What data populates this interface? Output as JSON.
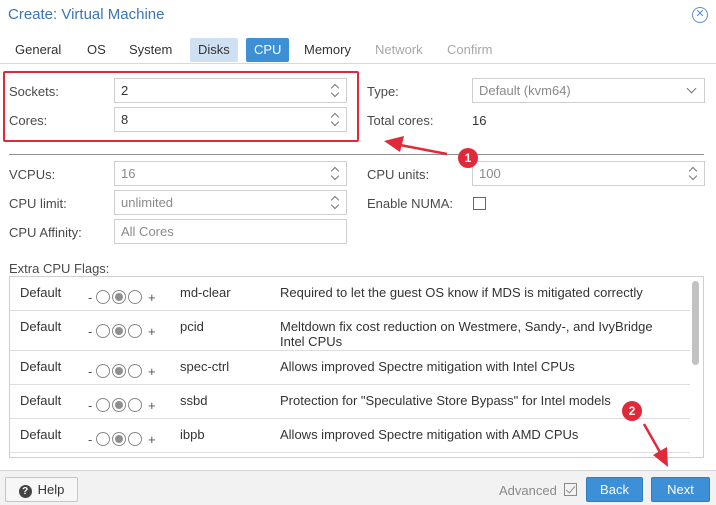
{
  "window": {
    "title": "Create: Virtual Machine"
  },
  "tabs": [
    {
      "label": "General"
    },
    {
      "label": "OS"
    },
    {
      "label": "System"
    },
    {
      "label": "Disks"
    },
    {
      "label": "CPU"
    },
    {
      "label": "Memory"
    },
    {
      "label": "Network"
    },
    {
      "label": "Confirm"
    }
  ],
  "cpu": {
    "sockets_label": "Sockets:",
    "sockets_value": "2",
    "cores_label": "Cores:",
    "cores_value": "8",
    "type_label": "Type:",
    "type_value": "Default (kvm64)",
    "total_cores_label": "Total cores:",
    "total_cores_value": "16",
    "vcpus_label": "VCPUs:",
    "vcpus_value": "16",
    "cpu_units_label": "CPU units:",
    "cpu_units_value": "100",
    "cpu_limit_label": "CPU limit:",
    "cpu_limit_value": "unlimited",
    "enable_numa_label": "Enable NUMA:",
    "cpu_affinity_label": "CPU Affinity:",
    "cpu_affinity_placeholder": "All Cores"
  },
  "flags": {
    "label": "Extra CPU Flags:",
    "minus": "-",
    "plus": "+",
    "rows": [
      {
        "state": "Default",
        "name": "md-clear",
        "description": "Required to let the guest OS know if MDS is mitigated correctly"
      },
      {
        "state": "Default",
        "name": "pcid",
        "description": "Meltdown fix cost reduction on Westmere, Sandy-, and IvyBridge Intel CPUs"
      },
      {
        "state": "Default",
        "name": "spec-ctrl",
        "description": "Allows improved Spectre mitigation with Intel CPUs"
      },
      {
        "state": "Default",
        "name": "ssbd",
        "description": "Protection for \"Speculative Store Bypass\" for Intel models"
      },
      {
        "state": "Default",
        "name": "ibpb",
        "description": "Allows improved Spectre mitigation with AMD CPUs"
      }
    ]
  },
  "footer": {
    "help_label": "Help",
    "advanced_label": "Advanced",
    "back_label": "Back",
    "next_label": "Next"
  },
  "annotations": {
    "badge1": "1",
    "badge2": "2"
  },
  "colors": {
    "accent": "#3d8fd6",
    "title": "#3c74b5",
    "annotation": "#e02a3a"
  }
}
